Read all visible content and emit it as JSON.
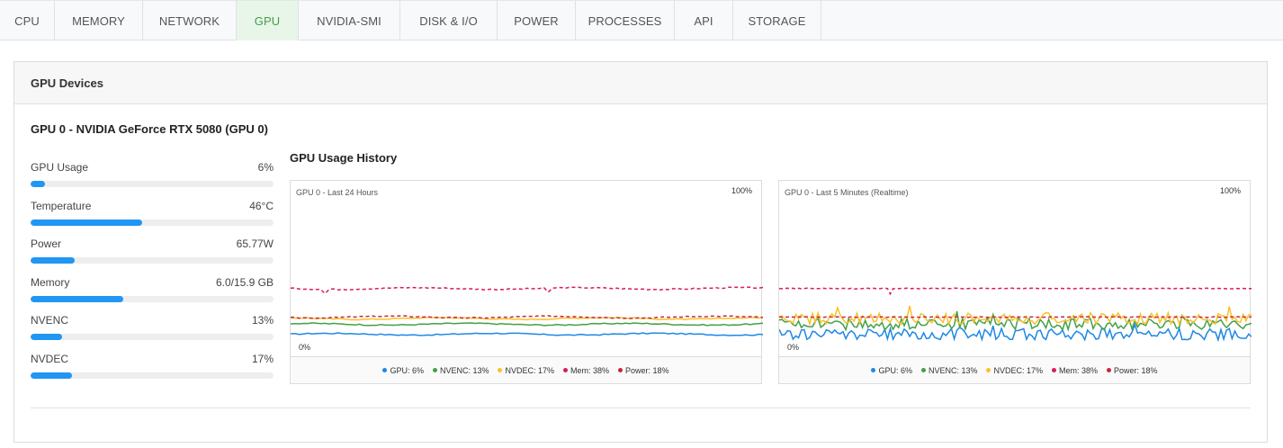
{
  "tabs": [
    {
      "label": "CPU",
      "width": 61
    },
    {
      "label": "MEMORY",
      "width": 98
    },
    {
      "label": "NETWORK",
      "width": 104
    },
    {
      "label": "GPU",
      "width": 69,
      "active": true
    },
    {
      "label": "NVIDIA-SMI",
      "width": 113
    },
    {
      "label": "DISK & I/O",
      "width": 108
    },
    {
      "label": "POWER",
      "width": 87
    },
    {
      "label": "PROCESSES",
      "width": 110
    },
    {
      "label": "API",
      "width": 65
    },
    {
      "label": "STORAGE",
      "width": 98
    }
  ],
  "panel": {
    "title": "GPU Devices"
  },
  "gpu": {
    "title": "GPU 0 - NVIDIA GeForce RTX 5080 (GPU 0)",
    "metrics": [
      {
        "label": "GPU Usage",
        "value": "6%",
        "level": 0.06
      },
      {
        "label": "Temperature",
        "value": "46°C",
        "level": 0.46
      },
      {
        "label": "Power",
        "value": "65.77W",
        "level": 0.18
      },
      {
        "label": "Memory",
        "value": "6.0/15.9 GB",
        "level": 0.38
      },
      {
        "label": "NVENC",
        "value": "13%",
        "level": 0.13
      },
      {
        "label": "NVDEC",
        "value": "17%",
        "level": 0.17
      }
    ]
  },
  "history": {
    "title": "GPU Usage History",
    "charts": [
      {
        "label": "GPU 0 - Last 24 Hours",
        "max": "100%",
        "min": "0%",
        "style": "smooth"
      },
      {
        "label": "GPU 0 - Last 5 Minutes (Realtime)",
        "max": "100%",
        "min": "0%",
        "style": "noisy"
      }
    ]
  },
  "chart_data": {
    "type": "line",
    "ylim": [
      0,
      100
    ],
    "series": [
      {
        "name": "GPU",
        "value": 6,
        "legend": "GPU: 6%",
        "color": "#1e88e5",
        "dash": false
      },
      {
        "name": "NVENC",
        "value": 13,
        "legend": "NVENC: 13%",
        "color": "#43a047",
        "dash": false
      },
      {
        "name": "NVDEC",
        "value": 17,
        "legend": "NVDEC: 17%",
        "color": "#fbc02d",
        "dash": false
      },
      {
        "name": "Mem",
        "value": 38,
        "legend": "Mem: 38%",
        "color": "#d81b60",
        "dash": true
      },
      {
        "name": "Power",
        "value": 18,
        "legend": "Power: 18%",
        "color": "#c62839",
        "dash": true
      }
    ]
  }
}
